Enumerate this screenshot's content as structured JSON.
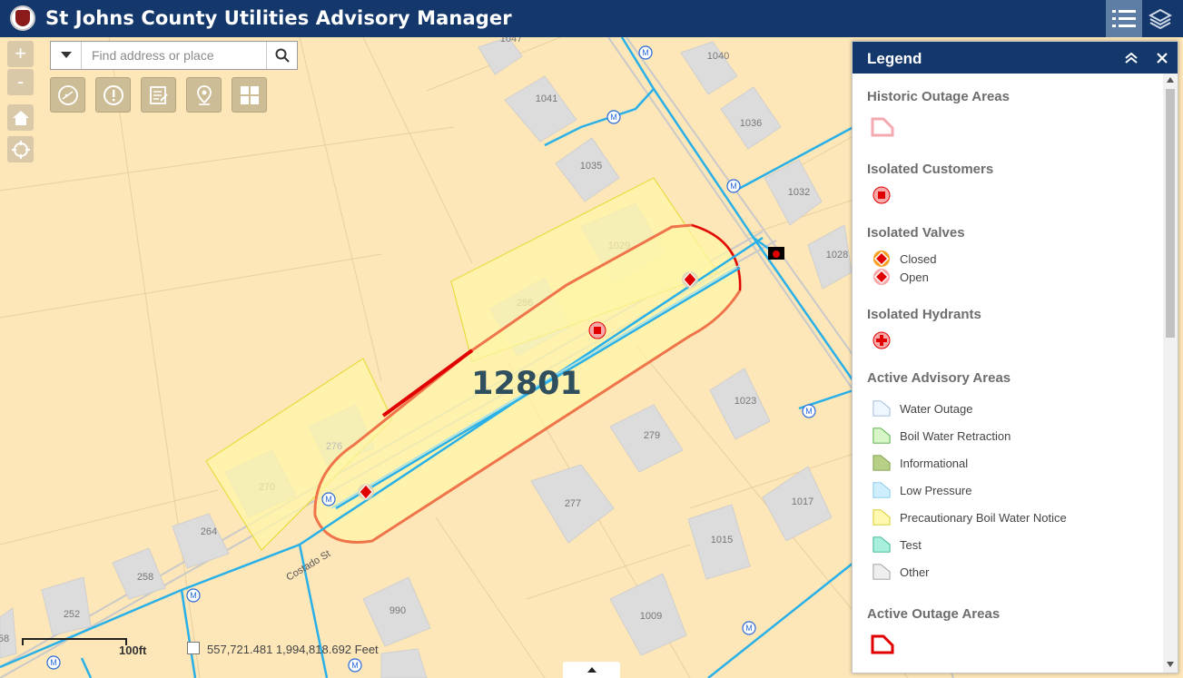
{
  "app": {
    "title": "St Johns County Utilities Advisory Manager"
  },
  "header": {
    "legend_icon": "list-icon",
    "layers_icon": "layers-icon"
  },
  "search": {
    "placeholder": "Find address or place",
    "value": ""
  },
  "toolbar": {
    "zoom_in": "+",
    "zoom_out": "-"
  },
  "map": {
    "advisory_label": "12801",
    "parcels": [
      "1047",
      "1040",
      "1041",
      "1036",
      "1035",
      "1032",
      "1028",
      "1029",
      "286",
      "1023",
      "279",
      "277",
      "1017",
      "1015",
      "1009",
      "990",
      "270",
      "264",
      "258",
      "252",
      "58",
      "276"
    ],
    "street_label": "Costado St",
    "scale_label": "100ft",
    "coordinates": "557,721.481  1,994,818.692 Feet"
  },
  "legend": {
    "title": "Legend",
    "sections": [
      {
        "title": "Historic Outage Areas",
        "items": []
      },
      {
        "title": "Isolated Customers",
        "items": []
      },
      {
        "title": "Isolated Valves",
        "items": [
          "Closed",
          "Open"
        ]
      },
      {
        "title": "Isolated Hydrants",
        "items": []
      },
      {
        "title": "Active Advisory Areas",
        "items": [
          "Water Outage",
          "Boil Water Retraction",
          "Informational",
          "Low Pressure",
          "Precautionary Boil Water Notice",
          "Test",
          "Other"
        ]
      },
      {
        "title": "Active Outage Areas",
        "items": []
      }
    ]
  },
  "colors": {
    "header": "#14386c",
    "map_bg": "#fde6b8",
    "water_line": "#2ab0e8",
    "advisory_outline": "#f0744a",
    "outage_red": "#e00000"
  }
}
